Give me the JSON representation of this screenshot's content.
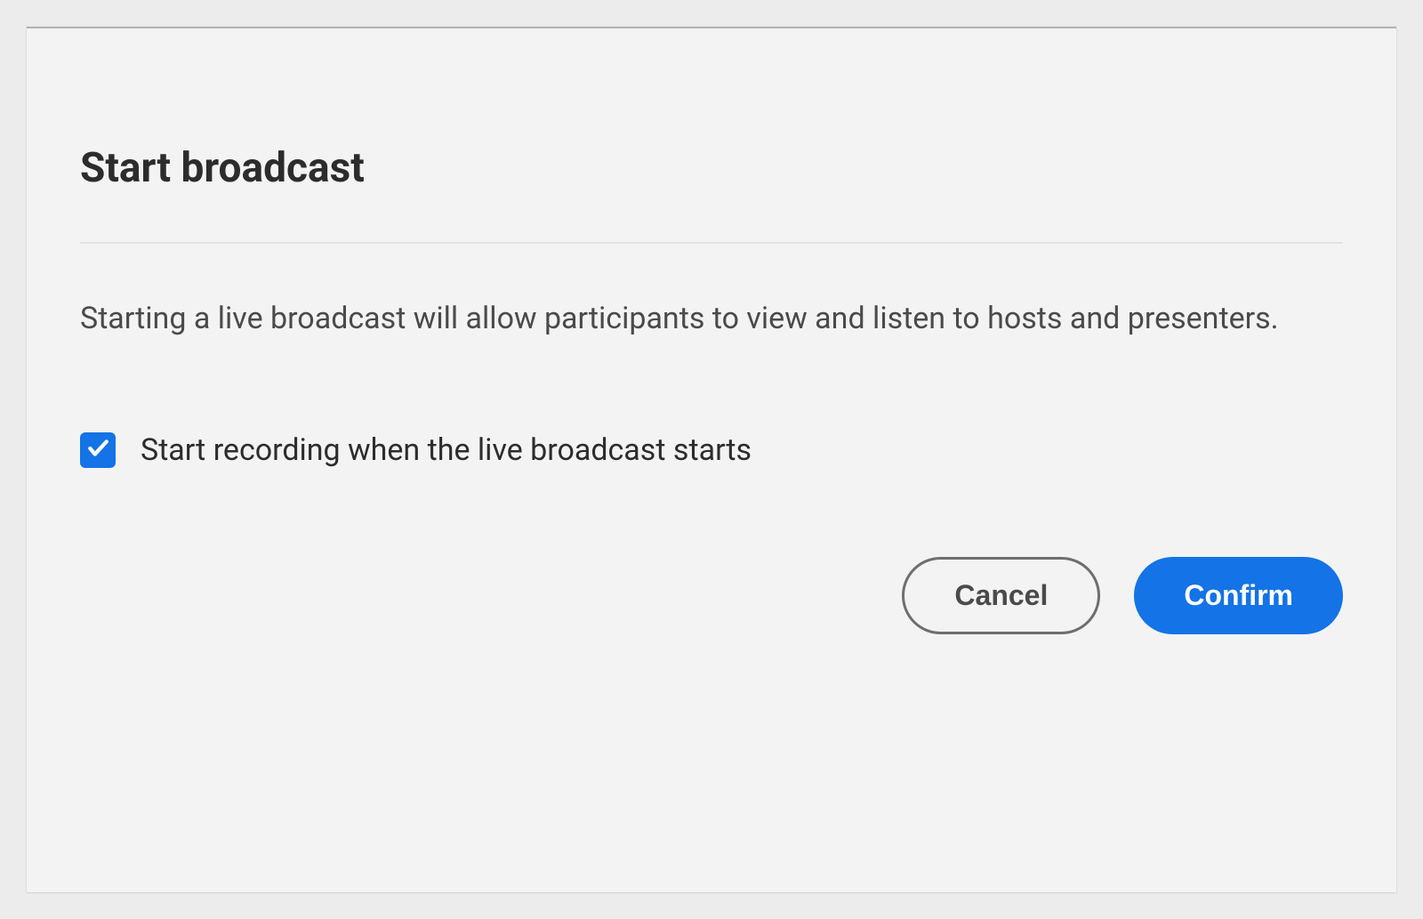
{
  "dialog": {
    "title": "Start broadcast",
    "description": "Starting a live broadcast will allow participants to view and listen to hosts and presenters.",
    "checkbox": {
      "label": "Start recording when the live broadcast starts",
      "checked": true
    },
    "buttons": {
      "cancel": "Cancel",
      "confirm": "Confirm"
    }
  },
  "colors": {
    "accent": "#1473e6"
  }
}
